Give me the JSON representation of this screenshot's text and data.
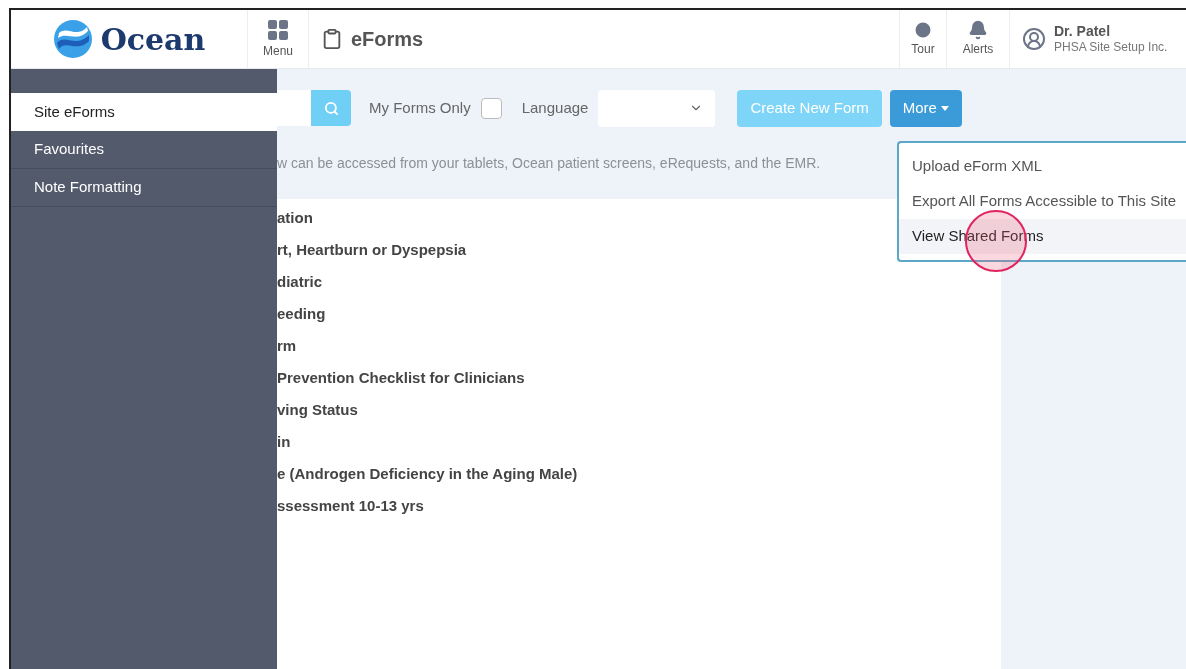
{
  "header": {
    "logo": "Ocean",
    "menu_label": "Menu",
    "page_title": "eForms",
    "tour_label": "Tour",
    "alerts_label": "Alerts",
    "user_name": "Dr. Patel",
    "user_org": "PHSA Site Setup Inc."
  },
  "sidebar": {
    "items": [
      {
        "label": "Site eForms",
        "selected": true
      },
      {
        "label": "Favourites",
        "selected": false
      },
      {
        "label": "Note Formatting",
        "selected": false
      }
    ]
  },
  "toolbar": {
    "my_forms_label": "My Forms Only",
    "my_forms_checked": false,
    "language_label": "Language",
    "create_button": "Create New Form",
    "more_button": "More"
  },
  "more_menu": {
    "items": [
      {
        "label": "Upload eForm XML",
        "highlighted": false
      },
      {
        "label": "Export All Forms Accessible to This Site",
        "highlighted": false
      },
      {
        "label": "View Shared Forms",
        "highlighted": true
      }
    ]
  },
  "info_text": "w can be accessed from your tablets, Ocean patient screens, eRequests, and the EMR.",
  "forms": [
    "ation",
    "rt, Heartburn or Dyspepsia",
    "diatric",
    "eeding",
    "rm",
    "Prevention Checklist for Clinicians",
    "ving Status",
    "in",
    "e (Androgen Deficiency in the Aging Male)",
    "ssessment 10-13 yrs"
  ]
}
